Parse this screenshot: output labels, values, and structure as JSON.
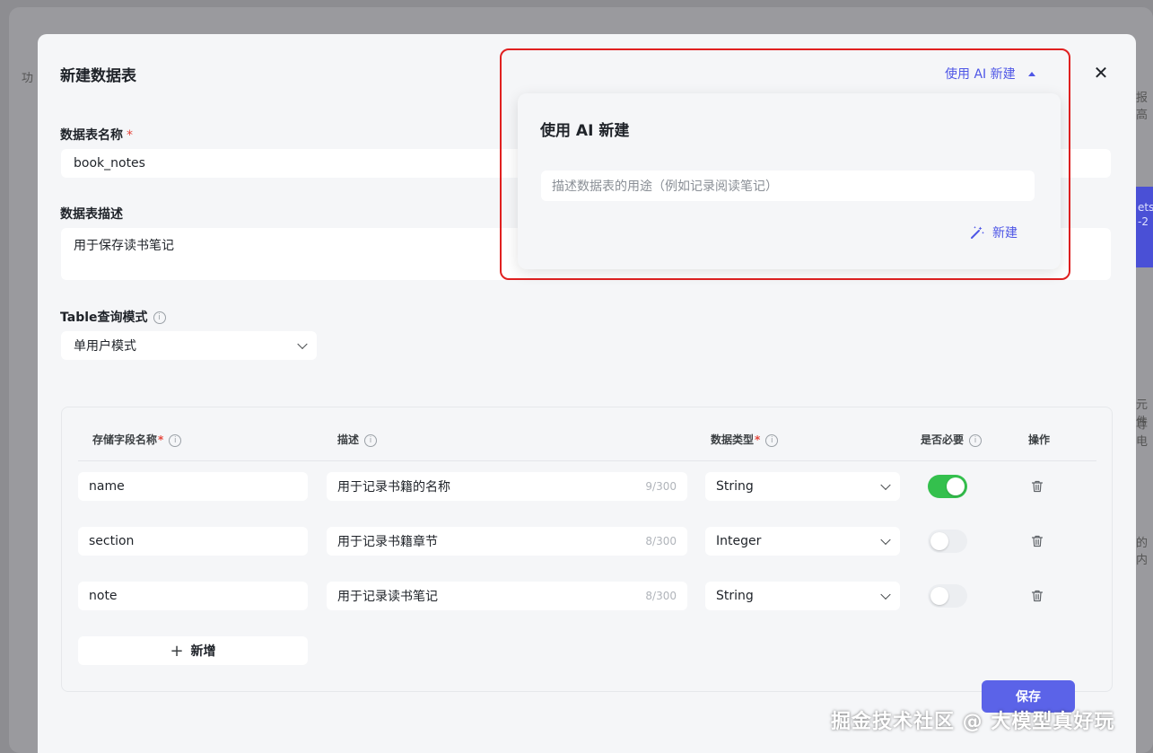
{
  "background": {
    "left_text": "功",
    "right_texts": [
      "报高",
      "ets",
      "-2",
      "元件",
      "尊电",
      "的内"
    ]
  },
  "modal": {
    "title": "新建数据表",
    "close_glyph": "✕",
    "table_name": {
      "label": "数据表名称",
      "required_mark": "*",
      "value": "book_notes"
    },
    "table_desc": {
      "label": "数据表描述",
      "value": "用于保存读书笔记"
    },
    "query_mode": {
      "label": "Table查询模式",
      "value": "单用户模式"
    },
    "fields_table": {
      "headers": [
        {
          "label": "存储字段名称",
          "required": "*"
        },
        {
          "label": "描述",
          "required": ""
        },
        {
          "label": "数据类型",
          "required": "*"
        },
        {
          "label": "是否必要",
          "required": ""
        },
        {
          "label": "操作",
          "required": ""
        }
      ],
      "rows": [
        {
          "name": "name",
          "desc": "用于记录书籍的名称",
          "count": "9/300",
          "type": "String",
          "required": true
        },
        {
          "name": "section",
          "desc": "用于记录书籍章节",
          "count": "8/300",
          "type": "Integer",
          "required": false
        },
        {
          "name": "note",
          "desc": "用于记录读书笔记",
          "count": "8/300",
          "type": "String",
          "required": false
        }
      ],
      "add_label": "新增",
      "add_glyph": "+"
    },
    "save_label": "保存"
  },
  "ai_panel": {
    "toggle_label": "使用 AI 新建",
    "title": "使用 AI 新建",
    "placeholder": "描述数据表的用途（例如记录阅读笔记）",
    "submit_label": "新建"
  },
  "watermark": "掘金技术社区 @ 大模型真好玩",
  "colors": {
    "accent": "#4e56e6",
    "primary_button": "#5b63e8",
    "toggle_on": "#34c04d",
    "highlight_outline": "#e02020",
    "required": "#e5463b"
  }
}
